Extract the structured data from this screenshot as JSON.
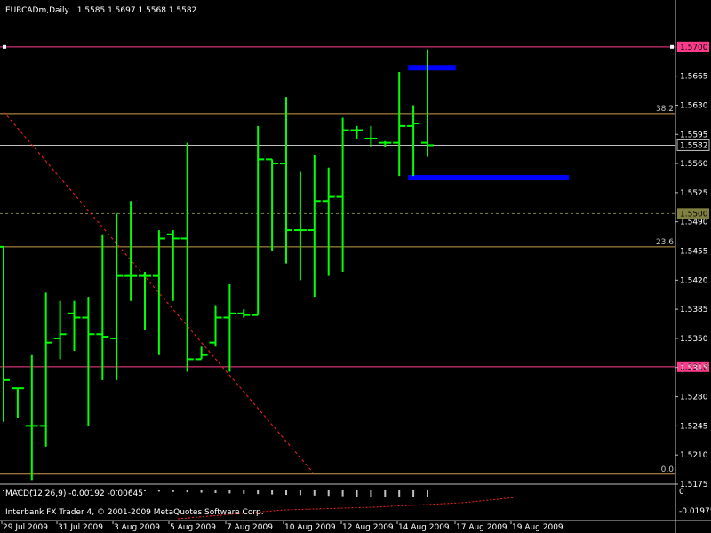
{
  "chart_data": {
    "type": "bar",
    "symbol_header": "EURCADm,Daily",
    "header_ohlc": "1.5585 1.5697 1.5568 1.5582",
    "ylim": [
      1.5175,
      1.5735
    ],
    "y_ticks": [
      "1.5665",
      "1.5630",
      "1.5595",
      "1.5560",
      "1.5525",
      "1.5490",
      "1.5455",
      "1.5420",
      "1.5385",
      "1.5350",
      "1.5315",
      "1.5280",
      "1.5245",
      "1.5210",
      "1.5175"
    ],
    "x_labels": [
      "29 Jul 2009",
      "31 Jul 2009",
      "3 Aug 2009",
      "5 Aug 2009",
      "7 Aug 2009",
      "10 Aug 2009",
      "12 Aug 2009",
      "14 Aug 2009",
      "17 Aug 2009",
      "19 Aug 2009"
    ],
    "bars": [
      {
        "o": 1.546,
        "h": 1.543,
        "l": 1.525,
        "c": 1.53
      },
      {
        "o": 1.529,
        "h": 1.529,
        "l": 1.5255,
        "c": 1.529
      },
      {
        "o": 1.5245,
        "h": 1.533,
        "l": 1.518,
        "c": 1.5245
      },
      {
        "o": 1.5245,
        "h": 1.5405,
        "l": 1.522,
        "c": 1.5345
      },
      {
        "o": 1.535,
        "h": 1.5395,
        "l": 1.5325,
        "c": 1.5355
      },
      {
        "o": 1.538,
        "h": 1.5395,
        "l": 1.5335,
        "c": 1.5375
      },
      {
        "o": 1.5375,
        "h": 1.54,
        "l": 1.5245,
        "c": 1.5355
      },
      {
        "o": 1.5355,
        "h": 1.5475,
        "l": 1.53,
        "c": 1.5352
      },
      {
        "o": 1.535,
        "h": 1.55,
        "l": 1.53,
        "c": 1.5425
      },
      {
        "o": 1.5425,
        "h": 1.5515,
        "l": 1.5395,
        "c": 1.5425
      },
      {
        "o": 1.5425,
        "h": 1.543,
        "l": 1.536,
        "c": 1.5425
      },
      {
        "o": 1.5425,
        "h": 1.548,
        "l": 1.533,
        "c": 1.547
      },
      {
        "o": 1.5475,
        "h": 1.548,
        "l": 1.5395,
        "c": 1.547
      },
      {
        "o": 1.547,
        "h": 1.5585,
        "l": 1.531,
        "c": 1.5325
      },
      {
        "o": 1.5325,
        "h": 1.534,
        "l": 1.5325,
        "c": 1.533
      },
      {
        "o": 1.5345,
        "h": 1.539,
        "l": 1.534,
        "c": 1.5375
      },
      {
        "o": 1.5375,
        "h": 1.5415,
        "l": 1.531,
        "c": 1.538
      },
      {
        "o": 1.538,
        "h": 1.5385,
        "l": 1.5375,
        "c": 1.5378
      },
      {
        "o": 1.5378,
        "h": 1.5605,
        "l": 1.5378,
        "c": 1.5565
      },
      {
        "o": 1.5565,
        "h": 1.555,
        "l": 1.5455,
        "c": 1.556
      },
      {
        "o": 1.556,
        "h": 1.564,
        "l": 1.544,
        "c": 1.548
      },
      {
        "o": 1.548,
        "h": 1.555,
        "l": 1.542,
        "c": 1.548
      },
      {
        "o": 1.548,
        "h": 1.557,
        "l": 1.54,
        "c": 1.5515
      },
      {
        "o": 1.5515,
        "h": 1.5555,
        "l": 1.5425,
        "c": 1.552
      },
      {
        "o": 1.552,
        "h": 1.5615,
        "l": 1.543,
        "c": 1.56
      },
      {
        "o": 1.56,
        "h": 1.5605,
        "l": 1.559,
        "c": 1.56
      },
      {
        "o": 1.559,
        "h": 1.5605,
        "l": 1.558,
        "c": 1.559
      },
      {
        "o": 1.5585,
        "h": 1.5587,
        "l": 1.558,
        "c": 1.5585
      },
      {
        "o": 1.5585,
        "h": 1.567,
        "l": 1.5545,
        "c": 1.5605
      },
      {
        "o": 1.5605,
        "h": 1.563,
        "l": 1.5545,
        "c": 1.5608
      },
      {
        "o": 1.5585,
        "h": 1.5697,
        "l": 1.5568,
        "c": 1.5582
      }
    ],
    "levels": [
      {
        "price": 1.57,
        "label": "1.5700",
        "color": "#ff3c8c",
        "kind": "box"
      },
      {
        "price": 1.562,
        "label": "38.2",
        "color": "#c8a050",
        "kind": "fib"
      },
      {
        "price": 1.5582,
        "label": "1.5582",
        "color": "#c0c0c0",
        "kind": "bidbox"
      },
      {
        "price": 1.55,
        "label": "1.5500",
        "color": "#808040",
        "kind": "dashbox"
      },
      {
        "price": 1.546,
        "label": "23.6",
        "color": "#c8a050",
        "kind": "fib"
      },
      {
        "price": 1.5316,
        "label": "1.5316",
        "color": "#ff3c8c",
        "kind": "box"
      },
      {
        "price": 1.5187,
        "label": "0.0",
        "color": "#c8a050",
        "kind": "fib"
      }
    ],
    "rectangles": [
      {
        "from_bar": 28,
        "to_bar": 32,
        "price": 1.5675,
        "color": "#0000ff"
      },
      {
        "from_bar": 28,
        "to_bar": 40,
        "price": 1.5543,
        "color": "#0000ff"
      }
    ],
    "macd": {
      "label": "MACD(12,26,9) -0.00192 -0.00645",
      "ticks": [
        "0",
        "-0.01975"
      ]
    },
    "copyright": "Interbank FX Trader 4, © 2001-2009 MetaQuotes Software Corp."
  }
}
